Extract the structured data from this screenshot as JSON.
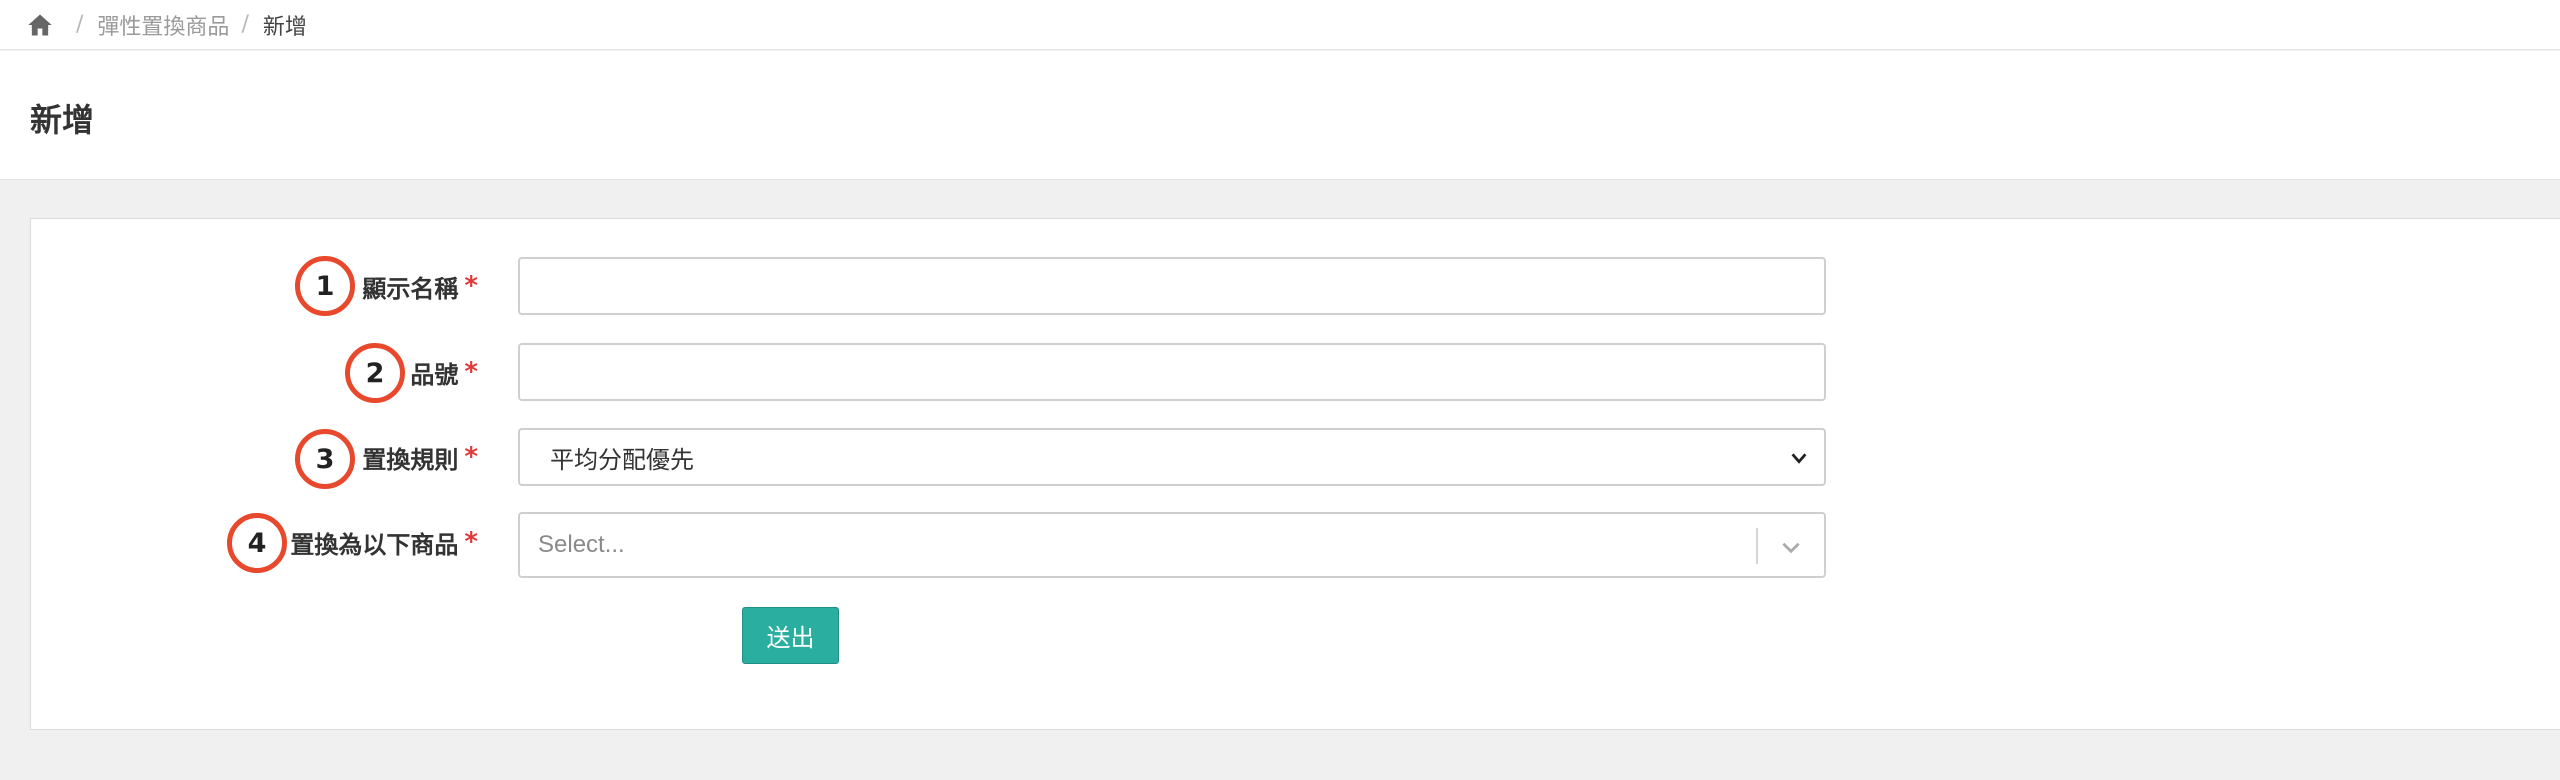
{
  "breadcrumb": {
    "home_icon": "home-icon",
    "separator": "/",
    "parent": "彈性置換商品",
    "current": "新增"
  },
  "page": {
    "title": "新增"
  },
  "form": {
    "fields": [
      {
        "badge": "1",
        "label": "顯示名稱",
        "required": "*",
        "value": ""
      },
      {
        "badge": "2",
        "label": "品號",
        "required": "*",
        "value": ""
      },
      {
        "badge": "3",
        "label": "置換規則",
        "required": "*",
        "value": "平均分配優先"
      },
      {
        "badge": "4",
        "label": "置換為以下商品",
        "required": "*",
        "placeholder": "Select..."
      }
    ],
    "submit_label": "送出"
  },
  "colors": {
    "accent": "#2aaea0",
    "required": "#e03a3a",
    "badge_ring": "#e8482b"
  }
}
